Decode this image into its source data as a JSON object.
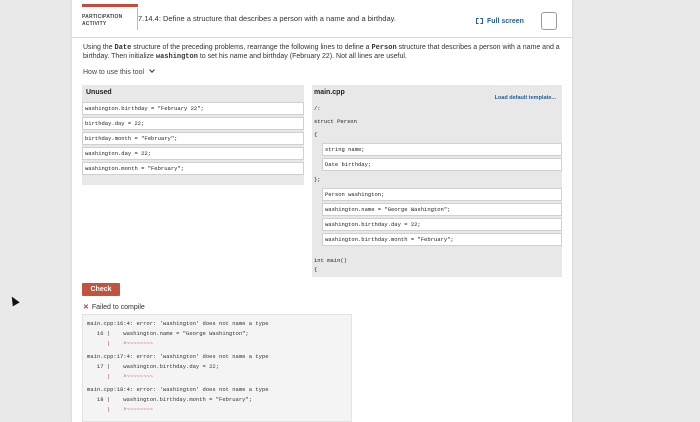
{
  "header": {
    "activity_label_line1": "PARTICIPATION",
    "activity_label_line2": "ACTIVITY",
    "title": "7.14.4: Define a structure that describes a person with a name and a birthday.",
    "fullscreen_label": "Full screen"
  },
  "description": {
    "part1": "Using the ",
    "code1": "Date",
    "part2": " structure of the preceding problems, rearrange the following lines to define a ",
    "code2": "Person",
    "part3": " structure that describes a person with a name and a birthday. Then initialize ",
    "code3": "washington",
    "part4": " to set his name and birthday (February 22). Not all lines are useful."
  },
  "howto_label": "How to use this tool",
  "unused_panel": {
    "title": "Unused",
    "lines": [
      "washington.birthday = \"February 22\";",
      "birthday.day = 22;",
      "birthday.month = \"February\";",
      "washington.day = 22;",
      "washington.month = \"February\";"
    ]
  },
  "main_panel": {
    "title": "main.cpp",
    "load_label": "Load default template...",
    "fixed": {
      "ellipsis": "/:",
      "struct_decl": "struct Person",
      "open_brace": "{",
      "close_struct": "};",
      "main_decl": "int main()",
      "main_open": "{"
    },
    "struct_lines": [
      "string name;",
      "Date birthday;"
    ],
    "main_lines": [
      "Person washington;",
      "washington.name = \"George Washington\";",
      "washington.birthday.day = 22;",
      "washington.birthday.month = \"February\";"
    ]
  },
  "check_label": "Check",
  "status_text": "Failed to compile",
  "console_lines": [
    "main.cpp:16:4: error: 'washington' does not name a type",
    "   16 |    washington.name = \"George Washington\";",
    "      |    ^~~~~~~~~",
    "main.cpp:17:4: error: 'washington' does not name a type",
    "   17 |    washington.birthday.day = 22;",
    "      |    ^~~~~~~~~",
    "main.cpp:18:4: error: 'washington' does not name a type",
    "   18 |    washington.birthday.month = \"February\";",
    "      |    ^~~~~~~~~"
  ],
  "colors": {
    "accent": "#c2533f",
    "link": "#1f5f9c",
    "panel_bg": "#e8e8e8"
  },
  "icons": {
    "fullscreen": "fullscreen-icon",
    "chevron": "chevron-down-icon",
    "error": "close-icon",
    "completion": "completion-badge-icon"
  }
}
